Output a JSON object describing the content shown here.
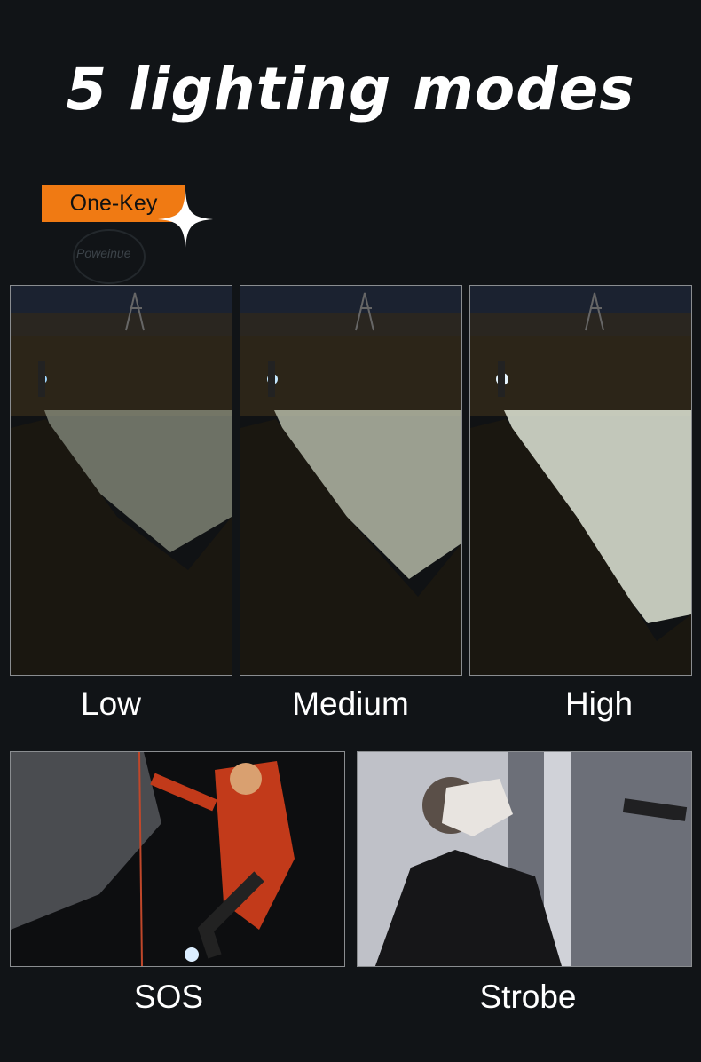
{
  "title": "5 lighting modes",
  "badge": {
    "label": "One-Key"
  },
  "watermark": "Poweinue",
  "modes": [
    {
      "label": "Low",
      "brightness": "low"
    },
    {
      "label": "Medium",
      "brightness": "medium"
    },
    {
      "label": "High",
      "brightness": "high"
    },
    {
      "label": "SOS"
    },
    {
      "label": "Strobe"
    }
  ],
  "colors": {
    "background": "#111417",
    "badge": "#f07a13",
    "text": "#ffffff"
  }
}
